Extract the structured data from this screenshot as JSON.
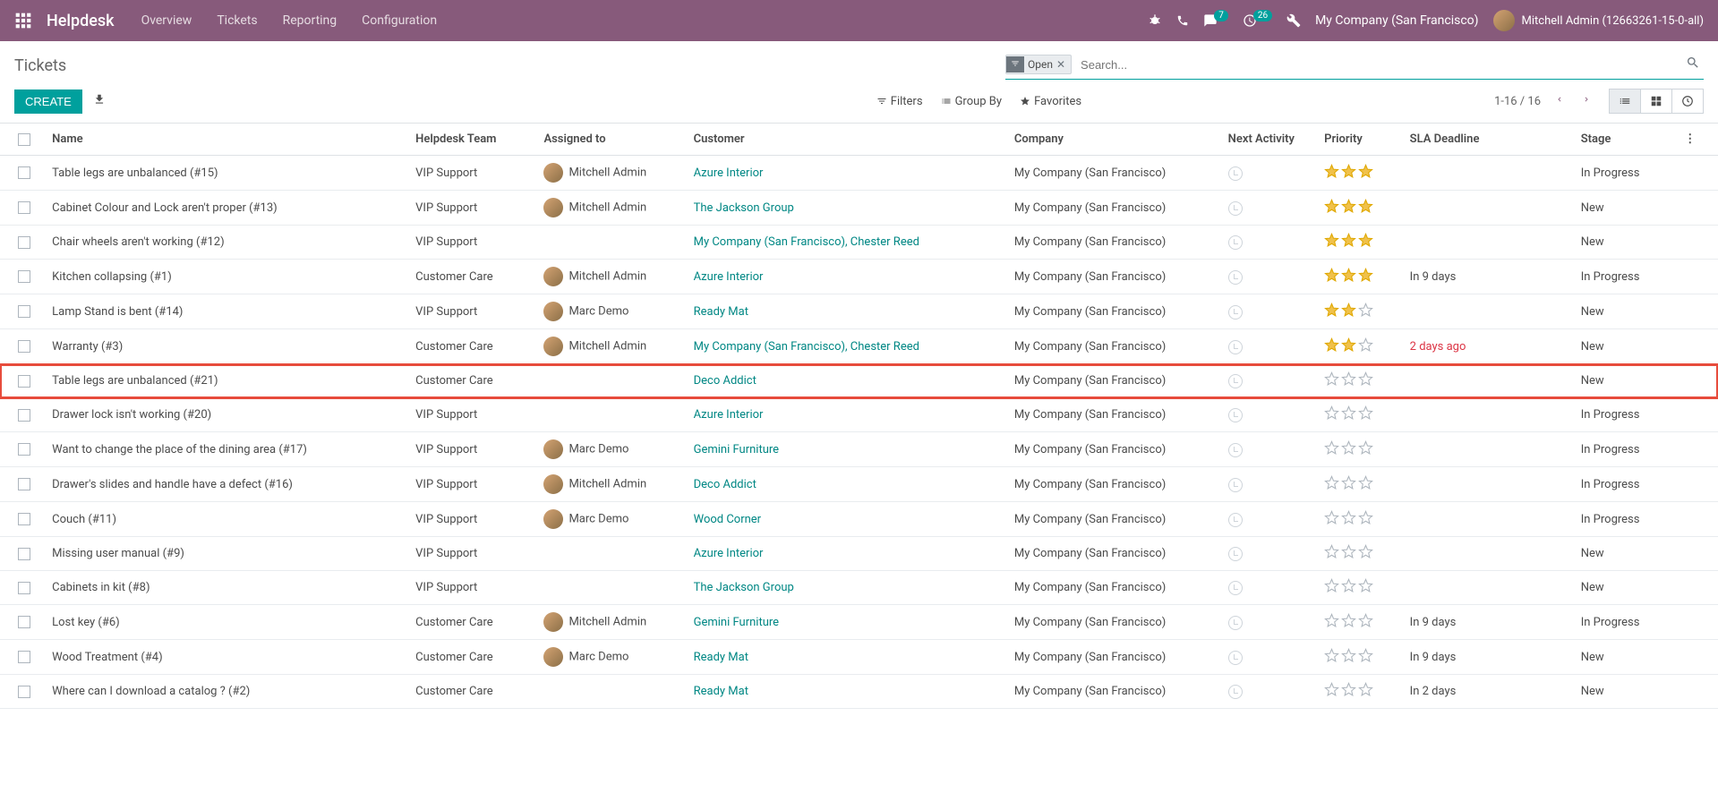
{
  "topbar": {
    "app_title": "Helpdesk",
    "nav": [
      "Overview",
      "Tickets",
      "Reporting",
      "Configuration"
    ],
    "msg_badge": "7",
    "activity_badge": "26",
    "company": "My Company (San Francisco)",
    "user": "Mitchell Admin (12663261-15-0-all)"
  },
  "control": {
    "page_title": "Tickets",
    "create_btn": "CREATE",
    "filter_tag": "Open",
    "search_placeholder": "Search...",
    "filters_label": "Filters",
    "groupby_label": "Group By",
    "favorites_label": "Favorites",
    "pager": "1-16 / 16"
  },
  "columns": {
    "name": "Name",
    "team": "Helpdesk Team",
    "assigned": "Assigned to",
    "customer": "Customer",
    "company": "Company",
    "activity": "Next Activity",
    "priority": "Priority",
    "deadline": "SLA Deadline",
    "stage": "Stage"
  },
  "rows": [
    {
      "name": "Table legs are unbalanced (#15)",
      "team": "VIP Support",
      "assigned": "Mitchell Admin",
      "has_avatar": true,
      "customer": "Azure Interior",
      "company": "My Company (San Francisco)",
      "priority": 3,
      "deadline": "",
      "deadline_overdue": false,
      "stage": "In Progress",
      "highlight": false
    },
    {
      "name": "Cabinet Colour and Lock aren't proper (#13)",
      "team": "VIP Support",
      "assigned": "Mitchell Admin",
      "has_avatar": true,
      "customer": "The Jackson Group",
      "company": "My Company (San Francisco)",
      "priority": 3,
      "deadline": "",
      "deadline_overdue": false,
      "stage": "New",
      "highlight": false
    },
    {
      "name": "Chair wheels aren't working (#12)",
      "team": "VIP Support",
      "assigned": "",
      "has_avatar": false,
      "customer": "My Company (San Francisco), Chester Reed",
      "company": "My Company (San Francisco)",
      "priority": 3,
      "deadline": "",
      "deadline_overdue": false,
      "stage": "New",
      "highlight": false
    },
    {
      "name": "Kitchen collapsing (#1)",
      "team": "Customer Care",
      "assigned": "Mitchell Admin",
      "has_avatar": true,
      "customer": "Azure Interior",
      "company": "My Company (San Francisco)",
      "priority": 3,
      "deadline": "In 9 days",
      "deadline_overdue": false,
      "stage": "In Progress",
      "highlight": false
    },
    {
      "name": "Lamp Stand is bent (#14)",
      "team": "VIP Support",
      "assigned": "Marc Demo",
      "has_avatar": true,
      "customer": "Ready Mat",
      "company": "My Company (San Francisco)",
      "priority": 2,
      "deadline": "",
      "deadline_overdue": false,
      "stage": "New",
      "highlight": false
    },
    {
      "name": "Warranty (#3)",
      "team": "Customer Care",
      "assigned": "Mitchell Admin",
      "has_avatar": true,
      "customer": "My Company (San Francisco), Chester Reed",
      "company": "My Company (San Francisco)",
      "priority": 2,
      "deadline": "2 days ago",
      "deadline_overdue": true,
      "stage": "New",
      "highlight": false
    },
    {
      "name": "Table legs are unbalanced (#21)",
      "team": "Customer Care",
      "assigned": "",
      "has_avatar": false,
      "customer": "Deco Addict",
      "company": "My Company (San Francisco)",
      "priority": 0,
      "deadline": "",
      "deadline_overdue": false,
      "stage": "New",
      "highlight": true
    },
    {
      "name": "Drawer lock isn't working (#20)",
      "team": "VIP Support",
      "assigned": "",
      "has_avatar": false,
      "customer": "Azure Interior",
      "company": "My Company (San Francisco)",
      "priority": 0,
      "deadline": "",
      "deadline_overdue": false,
      "stage": "In Progress",
      "highlight": false
    },
    {
      "name": "Want to change the place of the dining area (#17)",
      "team": "VIP Support",
      "assigned": "Marc Demo",
      "has_avatar": true,
      "customer": "Gemini Furniture",
      "company": "My Company (San Francisco)",
      "priority": 0,
      "deadline": "",
      "deadline_overdue": false,
      "stage": "In Progress",
      "highlight": false
    },
    {
      "name": "Drawer's slides and handle have a defect (#16)",
      "team": "VIP Support",
      "assigned": "Mitchell Admin",
      "has_avatar": true,
      "customer": "Deco Addict",
      "company": "My Company (San Francisco)",
      "priority": 0,
      "deadline": "",
      "deadline_overdue": false,
      "stage": "In Progress",
      "highlight": false
    },
    {
      "name": "Couch (#11)",
      "team": "VIP Support",
      "assigned": "Marc Demo",
      "has_avatar": true,
      "customer": "Wood Corner",
      "company": "My Company (San Francisco)",
      "priority": 0,
      "deadline": "",
      "deadline_overdue": false,
      "stage": "In Progress",
      "highlight": false
    },
    {
      "name": "Missing user manual (#9)",
      "team": "VIP Support",
      "assigned": "",
      "has_avatar": false,
      "customer": "Azure Interior",
      "company": "My Company (San Francisco)",
      "priority": 0,
      "deadline": "",
      "deadline_overdue": false,
      "stage": "New",
      "highlight": false
    },
    {
      "name": "Cabinets in kit (#8)",
      "team": "VIP Support",
      "assigned": "",
      "has_avatar": false,
      "customer": "The Jackson Group",
      "company": "My Company (San Francisco)",
      "priority": 0,
      "deadline": "",
      "deadline_overdue": false,
      "stage": "New",
      "highlight": false
    },
    {
      "name": "Lost key (#6)",
      "team": "Customer Care",
      "assigned": "Mitchell Admin",
      "has_avatar": true,
      "customer": "Gemini Furniture",
      "company": "My Company (San Francisco)",
      "priority": 0,
      "deadline": "In 9 days",
      "deadline_overdue": false,
      "stage": "In Progress",
      "highlight": false
    },
    {
      "name": "Wood Treatment (#4)",
      "team": "Customer Care",
      "assigned": "Marc Demo",
      "has_avatar": true,
      "customer": "Ready Mat",
      "company": "My Company (San Francisco)",
      "priority": 0,
      "deadline": "In 9 days",
      "deadline_overdue": false,
      "stage": "New",
      "highlight": false
    },
    {
      "name": "Where can I download a catalog ? (#2)",
      "team": "Customer Care",
      "assigned": "",
      "has_avatar": false,
      "customer": "Ready Mat",
      "company": "My Company (San Francisco)",
      "priority": 0,
      "deadline": "In 2 days",
      "deadline_overdue": false,
      "stage": "New",
      "highlight": false
    }
  ]
}
